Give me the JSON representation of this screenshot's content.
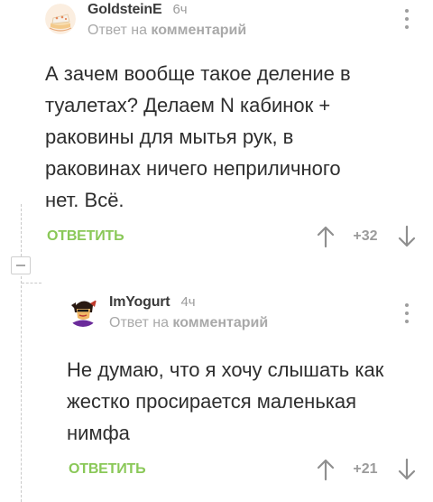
{
  "comments": [
    {
      "username": "GoldsteinE",
      "time": "6ч",
      "reply_prefix": "Ответ на",
      "reply_link": "комментарий",
      "text": "А зачем вообще такое деление в туалетах? Делаем N кабинок + раковины для мытья рук, в раковинах ничего неприличного нет. Всё.",
      "reply_label": "ОТВЕТИТЬ",
      "rating": "+32",
      "avatar_icon": "cake-avatar-icon"
    },
    {
      "username": "ImYogurt",
      "time": "4ч",
      "reply_prefix": "Ответ на",
      "reply_link": "комментарий",
      "text": "Не думаю, что я хочу слышать как жестко просирается маленькая нимфа",
      "reply_label": "ОТВЕТИТЬ",
      "rating": "+21",
      "avatar_icon": "cartoon-character-avatar-icon"
    }
  ],
  "colors": {
    "reply_green": "#8ac858",
    "meta_gray": "#a9a9a9",
    "text_dark": "#2e2e2e"
  },
  "icons": {
    "collapse": "minus-collapse-icon",
    "more": "vertical-dots-icon",
    "upvote": "arrow-up-icon",
    "downvote": "arrow-down-icon"
  }
}
